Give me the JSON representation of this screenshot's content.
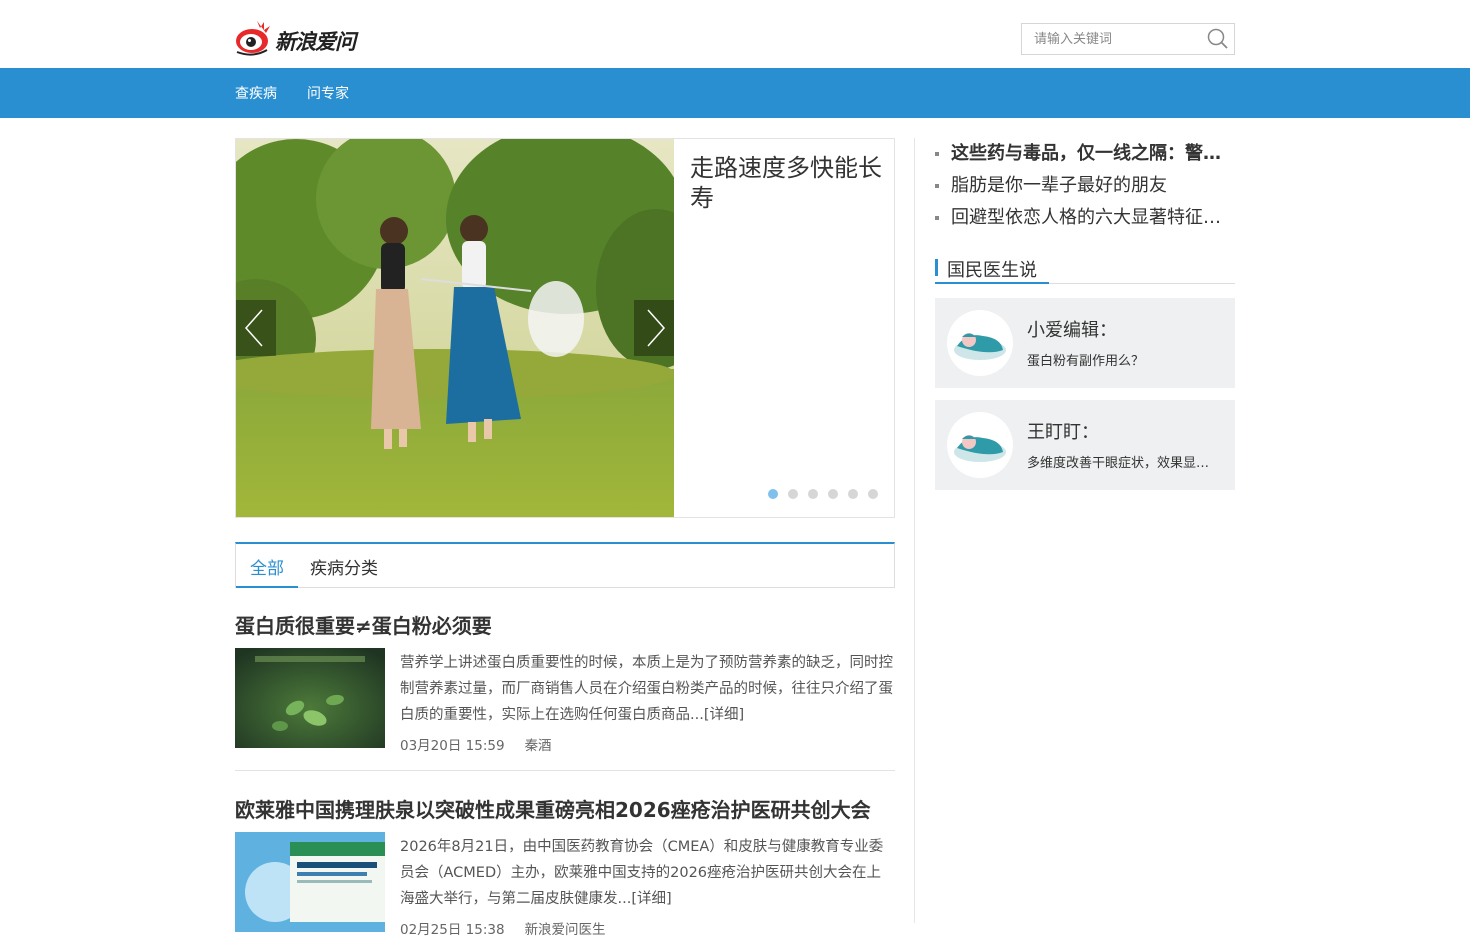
{
  "brand": {
    "name": "新浪爱问",
    "primary_color": "#2a8fd1"
  },
  "search": {
    "placeholder": "请输入关键词"
  },
  "nav": {
    "items": [
      {
        "label": "查疾病"
      },
      {
        "label": "问专家"
      }
    ]
  },
  "carousel": {
    "slide_title": "走路速度多快能长寿",
    "slide_count": 6,
    "active_index": 0
  },
  "hot_list": [
    {
      "label": "这些药与毒品，仅一线之隔：警…"
    },
    {
      "label": "脂肪是你一辈子最好的朋友"
    },
    {
      "label": "回避型依恋人格的六大显著特征…"
    }
  ],
  "doctor_section": {
    "title": "国民医生说",
    "cards": [
      {
        "name": "小爱编辑：",
        "question": "蛋白粉有副作用么？"
      },
      {
        "name": "王盯盯：",
        "question": "多维度改善干眼症状，效果显…"
      }
    ]
  },
  "tabs": [
    {
      "label": "全部"
    },
    {
      "label": "疾病分类"
    }
  ],
  "articles": [
    {
      "title": "蛋白质很重要≠蛋白粉必须要",
      "summary": "营养学上讲述蛋白质重要性的时候，本质上是为了预防营养素的缺乏，同时控制营养素过量，而厂商销售人员在介绍蛋白粉类产品的时候，往往只介绍了蛋白质的重要性，实际上在选购任何蛋白质商品...[详细]",
      "date": "03月20日 15:59",
      "author": "秦酒"
    },
    {
      "title": "欧莱雅中国携理肤泉以突破性成果重磅亮相2026痤疮治护医研共创大会",
      "summary": "2026年8月21日，由中国医药教育协会（CMEA）和皮肤与健康教育专业委员会（ACMED）主办，欧莱雅中国支持的2026痤疮治护医研共创大会在上海盛大举行，与第二届皮肤健康发...[详细]",
      "date": "02月25日 15:38",
      "author": "新浪爱问医生"
    }
  ]
}
